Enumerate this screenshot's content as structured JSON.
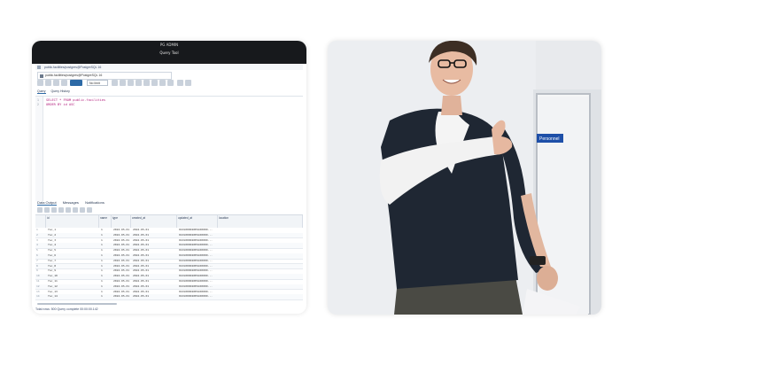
{
  "left_card": {
    "titlebar_top": "PG ADMIN",
    "titlebar_main": "Query Tool",
    "path": "public.facilities/postgres@PostgreSQL 16",
    "connection": "public.facilities/postgres@PostgreSQL 16",
    "toolbar_dropdown": "No limit",
    "editor_tabs": [
      "Query",
      "Query History"
    ],
    "code_lines": [
      {
        "num": "1",
        "text": "SELECT * FROM public.facilities"
      },
      {
        "num": "2",
        "text": "ORDER BY id ASC"
      }
    ],
    "output_tabs": [
      "Data Output",
      "Messages",
      "Notifications"
    ],
    "columns": [
      "id",
      "name",
      "type",
      "created_at",
      "updated_at",
      "location"
    ],
    "rows": [
      [
        "1",
        "fac_1",
        "1",
        "2024-05-01",
        "2024-05-01",
        "0101000020E6100000..."
      ],
      [
        "2",
        "fac_2",
        "1",
        "2024-05-01",
        "2024-05-01",
        "0101000020E6100000..."
      ],
      [
        "3",
        "fac_3",
        "1",
        "2024-05-01",
        "2024-05-01",
        "0101000020E6100000..."
      ],
      [
        "4",
        "fac_4",
        "1",
        "2024-05-01",
        "2024-05-01",
        "0101000020E6100000..."
      ],
      [
        "5",
        "fac_5",
        "1",
        "2024-05-01",
        "2024-05-01",
        "0101000020E6100000..."
      ],
      [
        "6",
        "fac_6",
        "1",
        "2024-05-01",
        "2024-05-01",
        "0101000020E6100000..."
      ],
      [
        "7",
        "fac_7",
        "1",
        "2024-05-01",
        "2024-05-01",
        "0101000020E6100000..."
      ],
      [
        "8",
        "fac_8",
        "1",
        "2024-05-01",
        "2024-05-01",
        "0101000020E6100000..."
      ],
      [
        "9",
        "fac_9",
        "1",
        "2024-05-01",
        "2024-05-01",
        "0101000020E6100000..."
      ],
      [
        "10",
        "fac_10",
        "1",
        "2024-05-01",
        "2024-05-01",
        "0101000020E6100000..."
      ],
      [
        "11",
        "fac_11",
        "1",
        "2024-05-01",
        "2024-05-01",
        "0101000020E6100000..."
      ],
      [
        "12",
        "fac_12",
        "1",
        "2024-05-01",
        "2024-05-01",
        "0101000020E6100000..."
      ],
      [
        "13",
        "fac_13",
        "1",
        "2024-05-01",
        "2024-05-01",
        "0101000020E6100000..."
      ],
      [
        "14",
        "fac_14",
        "1",
        "2024-05-01",
        "2024-05-01",
        "0101000020E6100000..."
      ]
    ],
    "status": "Total rows: 500   Query complete 00:00:00.142"
  },
  "right_card": {
    "door_sign": "Personnel",
    "accent_colors": {
      "shirt": "#1f2733",
      "cast": "#f2f2f2",
      "wall": "#e9ebee",
      "sign": "#1e4fa8"
    }
  }
}
